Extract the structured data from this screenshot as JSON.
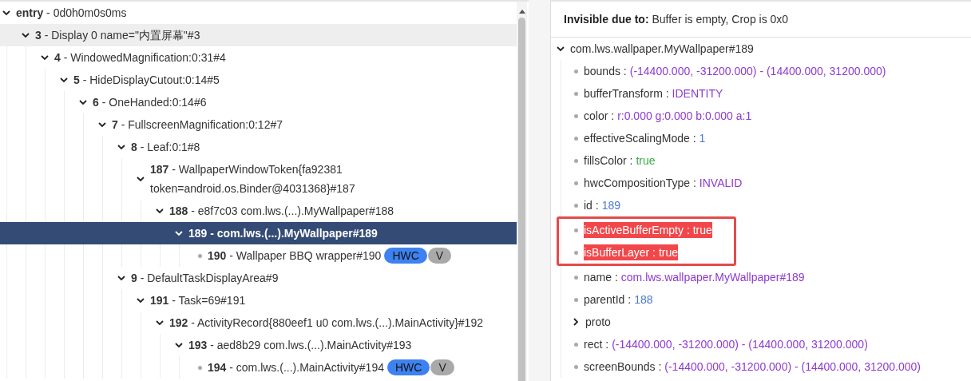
{
  "hierarchy": {
    "tree": {
      "id": "entry",
      "label": "- 0d0h0m0s0ms",
      "expanded": true,
      "selected": false,
      "hovered": false,
      "children": [
        {
          "id": "3",
          "label": "- Display 0 name=\"内置屏幕\"#3",
          "expanded": true,
          "selected": false,
          "hovered": true,
          "children": [
            {
              "id": "4",
              "label": "- WindowedMagnification:0:31#4",
              "expanded": true,
              "selected": false,
              "hovered": false,
              "children": [
                {
                  "id": "5",
                  "label": "- HideDisplayCutout:0:14#5",
                  "expanded": true,
                  "selected": false,
                  "hovered": false,
                  "children": [
                    {
                      "id": "6",
                      "label": "- OneHanded:0:14#6",
                      "expanded": true,
                      "selected": false,
                      "hovered": false,
                      "children": [
                        {
                          "id": "7",
                          "label": "- FullscreenMagnification:0:12#7",
                          "expanded": true,
                          "selected": false,
                          "hovered": false,
                          "children": [
                            {
                              "id": "8",
                              "label": "- Leaf:0:1#8",
                              "expanded": true,
                              "selected": false,
                              "hovered": false,
                              "children": [
                                {
                                  "id": "187",
                                  "label": "- WallpaperWindowToken{fa92381\ntoken=android.os.Binder@4031368}#187",
                                  "expanded": true,
                                  "selected": false,
                                  "hovered": false,
                                  "children": [
                                    {
                                      "id": "188",
                                      "label": "- e8f7c03 com.lws.(...).MyWallpaper#188",
                                      "expanded": true,
                                      "selected": false,
                                      "hovered": false,
                                      "children": [
                                        {
                                          "id": "189",
                                          "label": "- com.lws.(...).MyWallpaper#189",
                                          "expanded": true,
                                          "selected": true,
                                          "hovered": false,
                                          "children": [
                                            {
                                              "id": "190",
                                              "label": "- Wallpaper BBQ wrapper#190",
                                              "selected": false,
                                              "hovered": false,
                                              "badges": [
                                                {
                                                  "kind": "hwc",
                                                  "text": "HWC"
                                                },
                                                {
                                                  "kind": "visible",
                                                  "text": "V"
                                                }
                                              ]
                                            }
                                          ]
                                        }
                                      ]
                                    }
                                  ]
                                }
                              ]
                            },
                            {
                              "id": "9",
                              "label": "- DefaultTaskDisplayArea#9",
                              "expanded": true,
                              "selected": false,
                              "hovered": false,
                              "children": [
                                {
                                  "id": "191",
                                  "label": "- Task=69#191",
                                  "expanded": true,
                                  "selected": false,
                                  "hovered": false,
                                  "children": [
                                    {
                                      "id": "192",
                                      "label": "- ActivityRecord{880eef1 u0 com.lws.(...).MainActivity}#192",
                                      "expanded": true,
                                      "selected": false,
                                      "hovered": false,
                                      "children": [
                                        {
                                          "id": "193",
                                          "label": "- aed8b29 com.lws.(...).MainActivity#193",
                                          "expanded": true,
                                          "selected": false,
                                          "hovered": false,
                                          "children": [
                                            {
                                              "id": "194",
                                              "label": "- com.lws.(...).MainActivity#194",
                                              "selected": false,
                                              "hovered": false,
                                              "badges": [
                                                {
                                                  "kind": "hwc",
                                                  "text": "HWC"
                                                },
                                                {
                                                  "kind": "visible",
                                                  "text": "V"
                                                }
                                              ]
                                            }
                                          ]
                                        }
                                      ]
                                    }
                                  ]
                                }
                              ]
                            }
                          ]
                        }
                      ]
                    }
                  ]
                }
              ]
            }
          ]
        }
      ]
    }
  },
  "properties": {
    "notice": "**Invisible due to:** Buffer is empty, Crop is 0x0",
    "root": {
      "label": "com.lws.wallpaper.MyWallpaper#189",
      "expanded": true
    },
    "items": [
      {
        "kind": "property",
        "key": "bounds :",
        "value": "(-14400.000, -31200.000) - (14400.000, 31200.000)",
        "color": "#8e3ad0",
        "highlighted": false
      },
      {
        "kind": "property",
        "key": "bufferTransform :",
        "value": "IDENTITY",
        "color": "#8e3ad0",
        "highlighted": false
      },
      {
        "kind": "property",
        "key": "color :",
        "value": "r:0.000 g:0.000 b:0.000 a:1",
        "color": "#8e3ad0",
        "highlighted": false
      },
      {
        "kind": "property",
        "key": "effectiveScalingMode :",
        "value": "1",
        "color": "#4a78d4",
        "highlighted": false
      },
      {
        "kind": "property",
        "key": "fillsColor :",
        "value": "true",
        "color": "#3aaa48",
        "highlighted": false
      },
      {
        "kind": "property",
        "key": "hwcCompositionType :",
        "value": "INVALID",
        "color": "#8e3ad0",
        "highlighted": false
      },
      {
        "kind": "property",
        "key": "id :",
        "value": "189",
        "color": "#4a78d4",
        "highlighted": false
      },
      {
        "kind": "property",
        "key": "isActiveBufferEmpty :",
        "value": "true",
        "highlighted": true
      },
      {
        "kind": "property",
        "key": "isBufferLayer :",
        "value": "true",
        "highlighted": true
      },
      {
        "kind": "property",
        "key": "name :",
        "value": "com.lws.wallpaper.MyWallpaper#189",
        "color": "#8e3ad0",
        "highlighted": false
      },
      {
        "kind": "property",
        "key": "parentId :",
        "value": "188",
        "color": "#4a78d4",
        "highlighted": false
      },
      {
        "kind": "group",
        "key": "proto",
        "expanded": false
      },
      {
        "kind": "property",
        "key": "rect :",
        "value": "(-14400.000, -31200.000) - (14400.000, 31200.000)",
        "color": "#8e3ad0",
        "highlighted": false
      },
      {
        "kind": "property",
        "key": "screenBounds :",
        "value": "(-14400.000, -31200.000) - (14400.000, 31200.000)",
        "color": "#8e3ad0",
        "highlighted": false
      }
    ]
  }
}
